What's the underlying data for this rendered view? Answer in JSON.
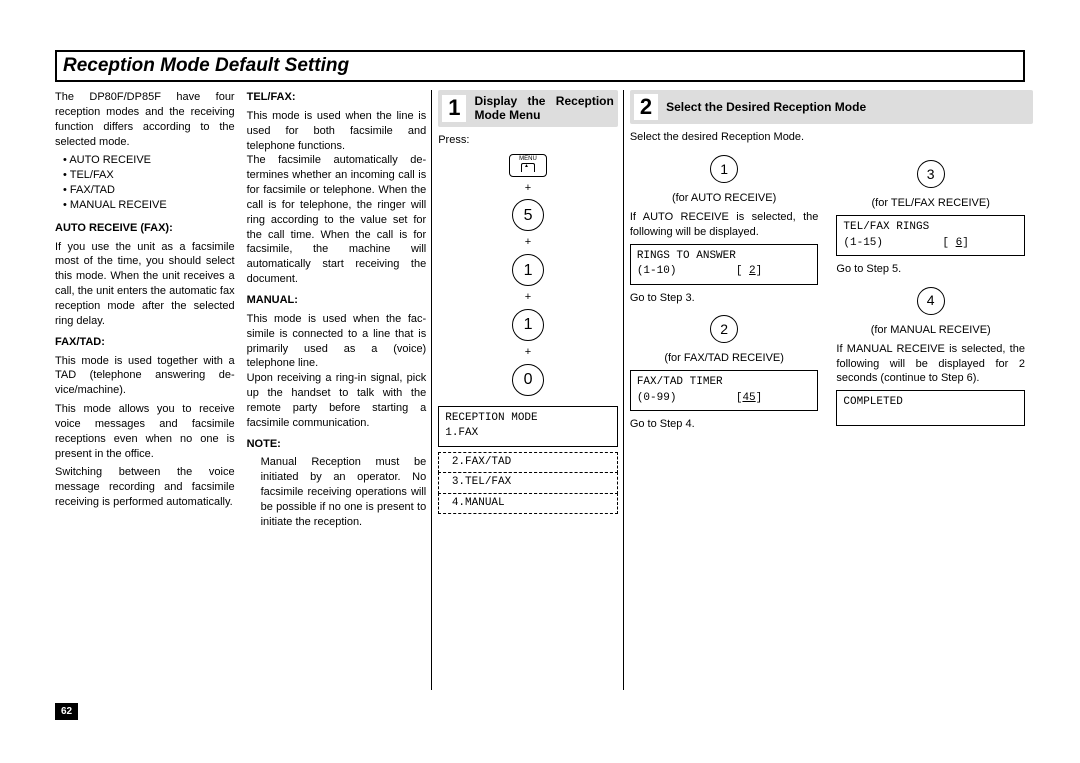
{
  "title": "Reception Mode Default Setting",
  "col1": {
    "intro": "The DP80F/DP85F have four reception modes and the receiv­ing function differs according to the selected mode.",
    "modes": [
      "AUTO RECEIVE",
      "TEL/FAX",
      "FAX/TAD",
      "MANUAL RECEIVE"
    ],
    "auto_head": "AUTO RECEIVE (FAX):",
    "auto_body": "If you use the unit as a facsimile most of the time, you should se­lect this mode. When the unit re­ceives a call, the unit enters the automatic fax reception mode after the selected ring delay.",
    "faxtad_head": "FAX/TAD:",
    "faxtad_body1": "This mode is used together with a TAD (telephone answering de­vice/machine).",
    "faxtad_body2": "This mode allows you to receive voice messages and facsimile receptions even when no one is present in the office.",
    "faxtad_body3": "Switching between the voice message recording and fac­simile receiving is performed au­tomatically."
  },
  "col2": {
    "telfax_head": "TEL/FAX:",
    "telfax_body": "This mode is used when the line is used for both facsimile and telephone functions.\nThe facsimile automatically de­termines whether an incoming call is for facsimile or telephone. When the call is for telephone, the ringer will ring according to the value set for the call time. When the call is for facsimile, the machine will automatically start receiving the document.",
    "manual_head": "MANUAL:",
    "manual_body": "This mode is used when the fac­simile is connected to a line that is primarily used as a (voice) telephone line.\nUpon receiving a ring-in signal, pick up the handset to talk with the remote party before starting a facsimile communication.",
    "note_head": "NOTE:",
    "note_body": "Manual Reception must be initiated by an operator. No facsimile receiving opera­tions will be possible if no one is present to initiate the reception."
  },
  "step1": {
    "num": "1",
    "title": "Display the Reception Mode Menu",
    "press": "Press:",
    "menu": "MENU",
    "keys": [
      "5",
      "1",
      "1",
      "0"
    ],
    "lcd_main": "RECEPTION MODE\n1.FAX",
    "lcd_d1": " 2.FAX/TAD",
    "lcd_d2": " 3.TEL/FAX",
    "lcd_d3": " 4.MANUAL"
  },
  "step2": {
    "num": "2",
    "title": "Select the Desired Reception Mode",
    "intro": "Select the desired Reception Mode.",
    "opt1": {
      "label": "(for AUTO RECEIVE)",
      "note": "If AUTO RECEIVE is selected, the following will be displayed.",
      "lcd": "RINGS TO ANSWER\n(1-10)         [ ",
      "val": "2",
      "goto": "Go to Step 3."
    },
    "opt2": {
      "label": "(for FAX/TAD RECEIVE)",
      "lcd": "FAX/TAD TIMER\n(0-99)         [",
      "val": "45",
      "goto": "Go to Step 4."
    },
    "opt3": {
      "label": "(for TEL/FAX RECEIVE)",
      "lcd": "TEL/FAX RINGS\n(1-15)         [ ",
      "val": "6",
      "goto": "Go to Step 5."
    },
    "opt4": {
      "label": "(for MANUAL RECEIVE)",
      "note": "If MANUAL RECEIVE is se­lected, the following will be dis­played for 2 seconds (continue to Step 6).",
      "lcd": "COMPLETED"
    }
  },
  "page": "62"
}
